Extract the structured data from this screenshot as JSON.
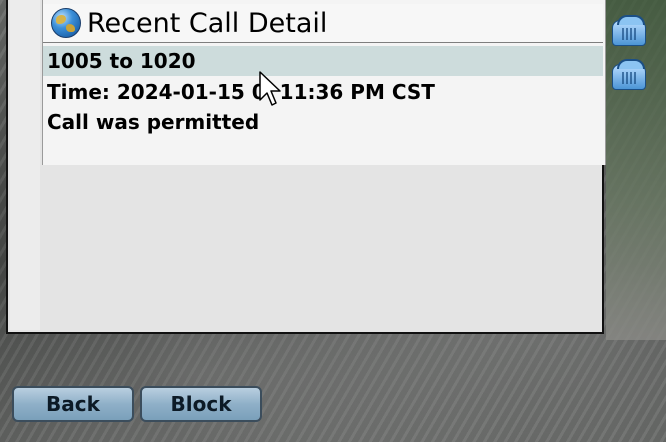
{
  "window": {
    "title": "Recent Call Detail",
    "title_icon": "globe-icon"
  },
  "call_detail": {
    "line1": "1005 to 1020",
    "line2": "Time: 2024-01-15 0",
    "line2_rest": "11:36 PM CST",
    "line3": "Call was permitted"
  },
  "line_buttons": [
    {
      "icon": "phone-icon"
    },
    {
      "icon": "phone-icon"
    }
  ],
  "softkeys": {
    "back": "Back",
    "block": "Block"
  },
  "colors": {
    "selected_row": "#cddcdc",
    "softkey": "#8fb0c8",
    "screen_bg": "#e4e4e4"
  }
}
